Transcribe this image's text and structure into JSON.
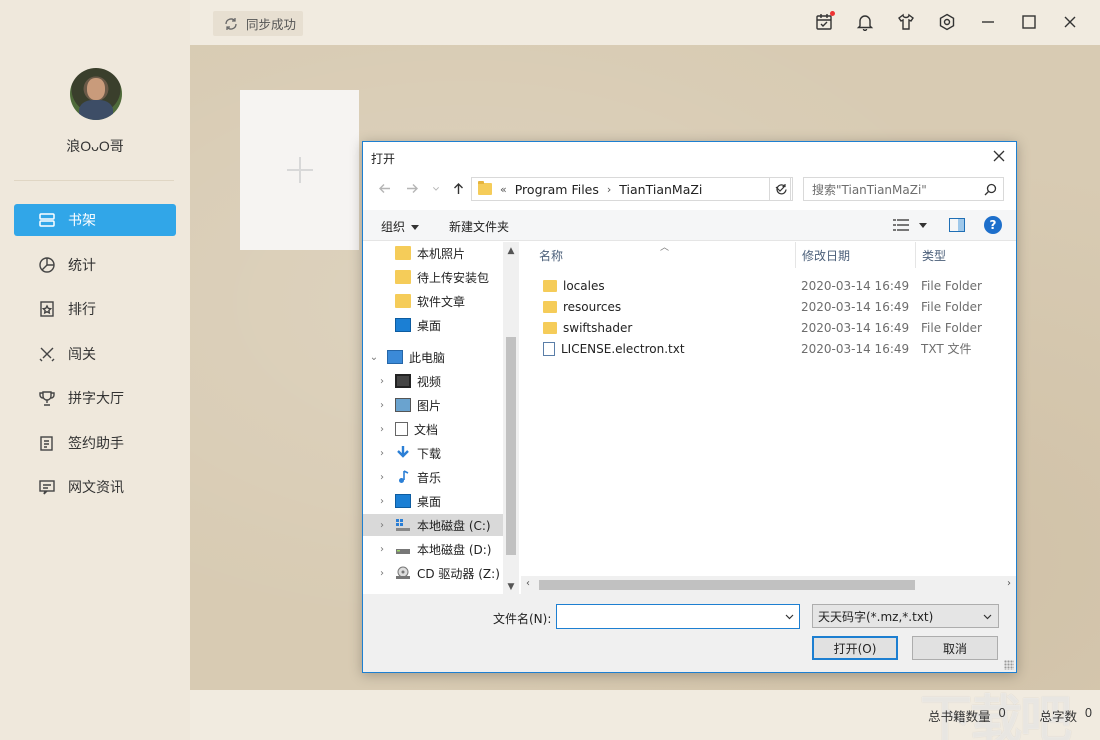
{
  "app": {
    "user": {
      "name": "浪OᴗO哥"
    },
    "sync_label": "同步成功",
    "nav": [
      {
        "label": "书架",
        "icon": "bookshelf-icon",
        "active": true
      },
      {
        "label": "统计",
        "icon": "pie-chart-icon"
      },
      {
        "label": "排行",
        "icon": "ranking-icon"
      },
      {
        "label": "闯关",
        "icon": "crossed-swords-icon"
      },
      {
        "label": "拼字大厅",
        "icon": "trophy-icon"
      },
      {
        "label": "签约助手",
        "icon": "contract-icon"
      },
      {
        "label": "网文资讯",
        "icon": "news-icon"
      }
    ],
    "topbar_icons": [
      "calendar-check-icon",
      "bell-icon",
      "tshirt-icon",
      "settings-icon",
      "minimize-icon",
      "maximize-icon",
      "close-icon"
    ],
    "footer": {
      "books_label": "总书籍数量",
      "books_value": "0",
      "words_label": "总字数",
      "words_value": "0"
    },
    "watermark": "下载吧",
    "accent_color": "#31a6e8"
  },
  "dialog": {
    "title": "打开",
    "address": {
      "overflow": "«",
      "segments": [
        "Program Files",
        "TianTianMaZi"
      ]
    },
    "search_placeholder": "搜索\"TianTianMaZi\"",
    "toolbar": {
      "organize": "组织",
      "new_folder": "新建文件夹"
    },
    "tree": [
      {
        "label": "本机照片",
        "icon": "folder-icon"
      },
      {
        "label": "待上传安装包",
        "icon": "folder-icon"
      },
      {
        "label": "软件文章",
        "icon": "folder-icon"
      },
      {
        "label": "桌面",
        "icon": "desktop-icon"
      },
      {
        "label": "此电脑",
        "icon": "computer-icon"
      },
      {
        "label": "视频",
        "icon": "video-icon"
      },
      {
        "label": "图片",
        "icon": "pictures-icon"
      },
      {
        "label": "文档",
        "icon": "documents-icon"
      },
      {
        "label": "下载",
        "icon": "download-icon"
      },
      {
        "label": "音乐",
        "icon": "music-icon"
      },
      {
        "label": "桌面",
        "icon": "desktop-icon"
      },
      {
        "label": "本地磁盘 (C:)",
        "icon": "drive-c-icon",
        "selected": true
      },
      {
        "label": "本地磁盘 (D:)",
        "icon": "drive-icon"
      },
      {
        "label": "CD 驱动器 (Z:)",
        "icon": "cd-drive-icon"
      }
    ],
    "columns": {
      "name": "名称",
      "date": "修改日期",
      "type": "类型"
    },
    "files": [
      {
        "name": "locales",
        "date": "2020-03-14 16:49",
        "type": "File Folder",
        "icon": "folder-icon"
      },
      {
        "name": "resources",
        "date": "2020-03-14 16:49",
        "type": "File Folder",
        "icon": "folder-icon"
      },
      {
        "name": "swiftshader",
        "date": "2020-03-14 16:49",
        "type": "File Folder",
        "icon": "folder-icon"
      },
      {
        "name": "LICENSE.electron.txt",
        "date": "2020-03-14 16:49",
        "type": "TXT 文件",
        "icon": "text-file-icon"
      }
    ],
    "filename_label": "文件名(N):",
    "filename_value": "",
    "filter": "天天码字(*.mz,*.txt)",
    "open_button": "打开(O)",
    "cancel_button": "取消"
  }
}
